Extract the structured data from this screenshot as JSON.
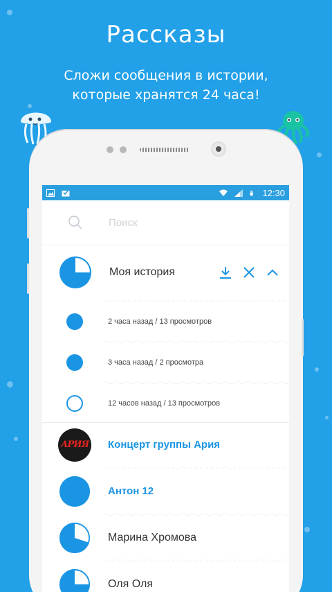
{
  "promo": {
    "title": "Рассказы",
    "subtitle_line1": "Сложи сообщения в истории,",
    "subtitle_line2": "которые хранятся 24 часа!"
  },
  "colors": {
    "background": "#22a0e8",
    "accent": "#1a95e4",
    "statusbar": "#2a9fe0"
  },
  "statusbar": {
    "left_icons": [
      "image-icon",
      "mail-check-icon"
    ],
    "right_icons": [
      "wifi-icon",
      "signal-icon",
      "battery-icon"
    ],
    "time": "12:30"
  },
  "search": {
    "icon": "search-icon",
    "placeholder": "Поиск"
  },
  "my_story": {
    "name": "Моя история",
    "progress_fraction": 0.25,
    "actions": [
      {
        "icon": "download-icon"
      },
      {
        "icon": "close-icon"
      },
      {
        "icon": "chevron-up-icon"
      }
    ],
    "items": [
      {
        "meta": "2 часа назад / 13 просмотров",
        "state": "filled"
      },
      {
        "meta": "3 часа назад / 2 просмотра",
        "state": "filled"
      },
      {
        "meta": "12 часов назад / 13 просмотров",
        "state": "hollow"
      }
    ]
  },
  "friends": [
    {
      "name": "Концерт группы Ария",
      "unread": true,
      "avatar": "aria-logo",
      "logo_text": "АРИЯ"
    },
    {
      "name": "Антон 12",
      "unread": true,
      "avatar": "full",
      "progress_fraction": 1.0
    },
    {
      "name": "Марина Хромова",
      "unread": false,
      "avatar": "pie",
      "progress_fraction": 0.3
    },
    {
      "name": "Оля Оля",
      "unread": false,
      "avatar": "pie",
      "progress_fraction": 0.25
    }
  ]
}
